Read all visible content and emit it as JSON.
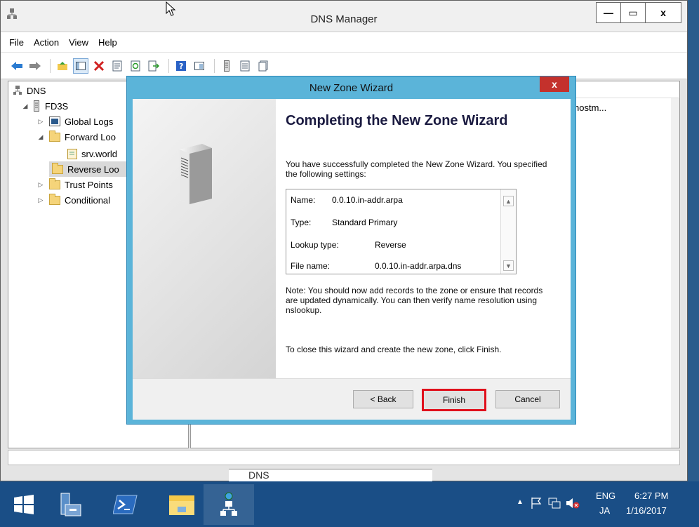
{
  "window": {
    "title": "DNS Manager",
    "controls": {
      "minimize": "—",
      "maximize": "▭",
      "close": "x"
    }
  },
  "menu": [
    "File",
    "Action",
    "View",
    "Help"
  ],
  "toolbar_icons": [
    "back-arrow-icon",
    "forward-arrow-icon",
    "folder-up-icon",
    "show-hide-tree-icon",
    "delete-icon",
    "properties-icon",
    "refresh-icon",
    "export-icon",
    "help-icon",
    "console-icon",
    "server-icon",
    "list-icon",
    "copy-icon"
  ],
  "tree": {
    "root": "DNS",
    "server": "FD3S",
    "items": [
      {
        "label": "Global Logs",
        "expander": "▷"
      },
      {
        "label": "Forward Loo",
        "expander": "◢"
      },
      {
        "label": "srv.world",
        "expander": ""
      },
      {
        "label": "Reverse Loo",
        "expander": ""
      },
      {
        "label": "Trust Points",
        "expander": "▷"
      },
      {
        "label": "Conditional",
        "expander": "▷"
      }
    ]
  },
  "right_pane": {
    "cell_text": "hostm..."
  },
  "background_fragment": {
    "text": "DNS"
  },
  "dialog": {
    "title": "New Zone Wizard",
    "close": "x",
    "heading": "Completing the New Zone Wizard",
    "intro": "You have successfully completed the New Zone Wizard. You specified the following settings:",
    "settings": [
      {
        "label": "Name:",
        "value": "0.0.10.in-addr.arpa"
      },
      {
        "label": "Type:",
        "value": "Standard Primary"
      },
      {
        "label": "Lookup type:",
        "value": "Reverse"
      },
      {
        "label": "File name:",
        "value": "0.0.10.in-addr.arpa.dns"
      }
    ],
    "note": "Note: You should now add records to the zone or ensure that records are updated dynamically. You can then verify name resolution using nslookup.",
    "close_instruction": "To close this wizard and create the new zone, click Finish.",
    "buttons": {
      "back": "< Back",
      "finish": "Finish",
      "cancel": "Cancel"
    }
  },
  "taskbar": {
    "apps": [
      "start-windows-icon",
      "server-manager-icon",
      "powershell-icon",
      "file-explorer-icon",
      "dns-manager-icon"
    ],
    "tray": {
      "lang": "ENG",
      "ime": "JA",
      "time": "6:27 PM",
      "date": "1/16/2017"
    }
  }
}
